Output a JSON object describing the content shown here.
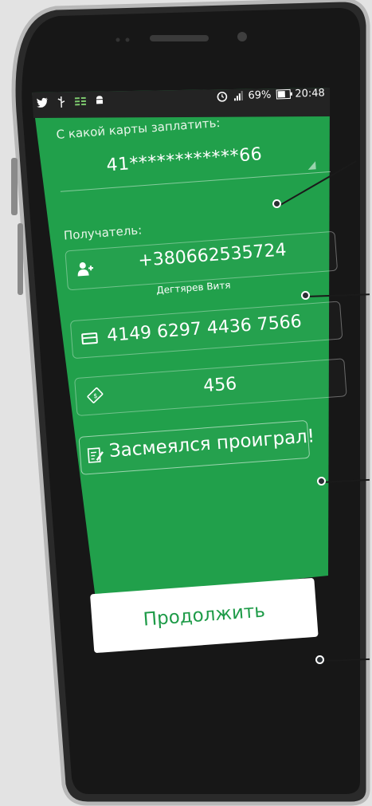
{
  "status_bar": {
    "battery_percent": "69%",
    "time": "20:48",
    "battery_level": 0.69
  },
  "payment_form": {
    "source_card_label": "С какой карты заплатить:",
    "source_card_value": "41************66",
    "recipient_label": "Получатель:",
    "recipient_phone": "+380662535724",
    "recipient_name": "Дегтярев Витя",
    "card_number": "4149 6297 4436 7566",
    "amount": "456",
    "comment": "Засмеялся проиграл!",
    "continue_label": "Продолжить"
  },
  "colors": {
    "screen_green": "#21a04b",
    "button_text": "#1e9b48",
    "bezel": "#1f1f1f",
    "background": "#e3e3e3"
  }
}
